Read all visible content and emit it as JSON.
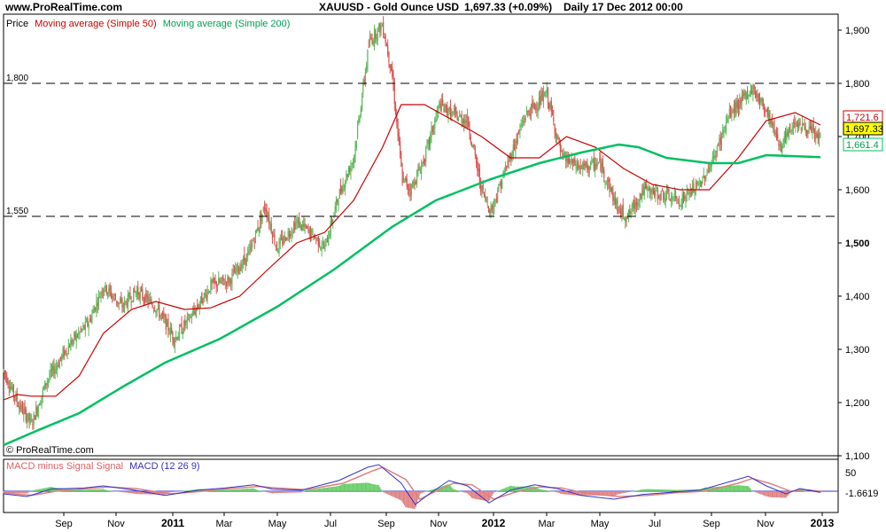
{
  "header": {
    "site": "www.ProRealTime.com",
    "instrument": "XAUUSD - Gold Ounce USD",
    "last_price": "1,697.33 (+0.09%)",
    "period": "Daily  17 Dec 2012 00:00"
  },
  "legend": {
    "price": "Price",
    "ma50": "Moving average (Simple 50)",
    "ma200": "Moving average (Simple 200)"
  },
  "watermark": "© ProRealTime.com",
  "macd_legend": {
    "hist": "MACD minus Signal Signal",
    "macd": "MACD (12 26 9)"
  },
  "colors": {
    "up": "#5cb85c",
    "down": "#d9534f",
    "ma50": "#cc0000",
    "ma200": "#00c060",
    "last_price_bg": "#ffff00",
    "macd_line": "#3333cc",
    "signal_line": "#e08080",
    "macd_hist": "#66cc66"
  },
  "chart_data": {
    "type": "line",
    "title": "XAUUSD - Gold Ounce USD",
    "ylim": [
      1100,
      1930
    ],
    "y_ticks": [
      {
        "value": 1100,
        "label": "1,100",
        "bold": false
      },
      {
        "value": 1200,
        "label": "1,200",
        "bold": false
      },
      {
        "value": 1300,
        "label": "1,300",
        "bold": false
      },
      {
        "value": 1400,
        "label": "1,400",
        "bold": false
      },
      {
        "value": 1500,
        "label": "1,500",
        "bold": true
      },
      {
        "value": 1600,
        "label": "1,600",
        "bold": false
      },
      {
        "value": 1700,
        "label": "1,700",
        "bold": false
      },
      {
        "value": 1800,
        "label": "1,800",
        "bold": false
      },
      {
        "value": 1900,
        "label": "1,900",
        "bold": false
      }
    ],
    "x_ticks": [
      "Sep",
      "Nov",
      "2011",
      "Mar",
      "May",
      "Jul",
      "Sep",
      "Nov",
      "2012",
      "Mar",
      "May",
      "Jul",
      "Sep",
      "Nov",
      "2013"
    ],
    "x_range": [
      "2010-07-26",
      "2013-01-05"
    ],
    "horizontal_lines": [
      {
        "value": 1800,
        "label": "1,800"
      },
      {
        "value": 1550,
        "label": "1,550"
      }
    ],
    "price_path": [
      [
        "2010-07-26",
        1260
      ],
      [
        "2010-08-10",
        1200
      ],
      [
        "2010-08-25",
        1160
      ],
      [
        "2010-09-10",
        1240
      ],
      [
        "2010-10-05",
        1310
      ],
      [
        "2010-10-25",
        1350
      ],
      [
        "2010-11-10",
        1420
      ],
      [
        "2010-11-30",
        1380
      ],
      [
        "2010-12-15",
        1410
      ],
      [
        "2011-01-05",
        1380
      ],
      [
        "2011-01-25",
        1320
      ],
      [
        "2011-02-15",
        1370
      ],
      [
        "2011-03-05",
        1420
      ],
      [
        "2011-03-25",
        1430
      ],
      [
        "2011-04-15",
        1480
      ],
      [
        "2011-05-02",
        1570
      ],
      [
        "2011-05-15",
        1490
      ],
      [
        "2011-06-05",
        1540
      ],
      [
        "2011-06-25",
        1510
      ],
      [
        "2011-07-05",
        1490
      ],
      [
        "2011-07-20",
        1590
      ],
      [
        "2011-08-05",
        1660
      ],
      [
        "2011-08-15",
        1790
      ],
      [
        "2011-08-22",
        1880
      ],
      [
        "2011-09-05",
        1910
      ],
      [
        "2011-09-15",
        1820
      ],
      [
        "2011-09-26",
        1620
      ],
      [
        "2011-10-05",
        1600
      ],
      [
        "2011-10-20",
        1660
      ],
      [
        "2011-11-05",
        1760
      ],
      [
        "2011-11-20",
        1740
      ],
      [
        "2011-12-05",
        1730
      ],
      [
        "2011-12-20",
        1600
      ],
      [
        "2011-12-30",
        1560
      ],
      [
        "2012-01-15",
        1640
      ],
      [
        "2012-02-05",
        1740
      ],
      [
        "2012-02-28",
        1780
      ],
      [
        "2012-03-15",
        1660
      ],
      [
        "2012-04-05",
        1640
      ],
      [
        "2012-04-25",
        1650
      ],
      [
        "2012-05-15",
        1560
      ],
      [
        "2012-05-25",
        1550
      ],
      [
        "2012-06-10",
        1600
      ],
      [
        "2012-06-30",
        1590
      ],
      [
        "2012-07-20",
        1580
      ],
      [
        "2012-08-10",
        1610
      ],
      [
        "2012-08-25",
        1660
      ],
      [
        "2012-09-10",
        1740
      ],
      [
        "2012-10-05",
        1790
      ],
      [
        "2012-10-20",
        1750
      ],
      [
        "2012-11-05",
        1680
      ],
      [
        "2012-11-20",
        1730
      ],
      [
        "2012-12-05",
        1710
      ],
      [
        "2012-12-17",
        1697
      ]
    ],
    "series": [
      {
        "name": "Moving average (Simple 50)",
        "last_label": "1,721.6",
        "points": [
          [
            "2010-07-26",
            1205
          ],
          [
            "2010-08-10",
            1215
          ],
          [
            "2010-08-25",
            1212
          ],
          [
            "2010-09-20",
            1212
          ],
          [
            "2010-10-15",
            1250
          ],
          [
            "2010-11-10",
            1330
          ],
          [
            "2010-12-10",
            1375
          ],
          [
            "2011-01-05",
            1390
          ],
          [
            "2011-02-05",
            1375
          ],
          [
            "2011-03-05",
            1378
          ],
          [
            "2011-04-05",
            1400
          ],
          [
            "2011-05-05",
            1450
          ],
          [
            "2011-06-05",
            1500
          ],
          [
            "2011-07-05",
            1520
          ],
          [
            "2011-08-05",
            1580
          ],
          [
            "2011-09-05",
            1680
          ],
          [
            "2011-09-25",
            1760
          ],
          [
            "2011-10-20",
            1760
          ],
          [
            "2011-11-20",
            1730
          ],
          [
            "2011-12-20",
            1700
          ],
          [
            "2012-01-20",
            1660
          ],
          [
            "2012-02-20",
            1660
          ],
          [
            "2012-03-20",
            1700
          ],
          [
            "2012-04-20",
            1680
          ],
          [
            "2012-05-20",
            1640
          ],
          [
            "2012-06-20",
            1610
          ],
          [
            "2012-07-20",
            1600
          ],
          [
            "2012-08-20",
            1600
          ],
          [
            "2012-09-20",
            1660
          ],
          [
            "2012-10-20",
            1730
          ],
          [
            "2012-11-20",
            1745
          ],
          [
            "2012-12-17",
            1721.6
          ]
        ]
      },
      {
        "name": "Moving average (Simple 200)",
        "last_label": "1,661.4",
        "points": [
          [
            "2010-07-26",
            1120
          ],
          [
            "2010-09-01",
            1148
          ],
          [
            "2010-10-15",
            1180
          ],
          [
            "2010-12-01",
            1230
          ],
          [
            "2011-01-15",
            1275
          ],
          [
            "2011-03-15",
            1320
          ],
          [
            "2011-05-15",
            1380
          ],
          [
            "2011-07-15",
            1450
          ],
          [
            "2011-09-15",
            1530
          ],
          [
            "2011-11-01",
            1580
          ],
          [
            "2011-12-30",
            1620
          ],
          [
            "2012-02-20",
            1650
          ],
          [
            "2012-04-05",
            1670
          ],
          [
            "2012-05-15",
            1685
          ],
          [
            "2012-06-05",
            1680
          ],
          [
            "2012-07-05",
            1660
          ],
          [
            "2012-08-20",
            1650
          ],
          [
            "2012-09-20",
            1650
          ],
          [
            "2012-10-20",
            1665
          ],
          [
            "2012-12-17",
            1661.4
          ]
        ]
      }
    ],
    "last_price_label": "1,697.33",
    "macd": {
      "ylim": [
        -40,
        60
      ],
      "y_tick": {
        "value": 50,
        "label": "50"
      },
      "last_label": "-1.6619",
      "macd_path": [
        [
          "2010-07-26",
          -5
        ],
        [
          "2010-08-20",
          -10
        ],
        [
          "2010-09-15",
          4
        ],
        [
          "2010-10-20",
          6
        ],
        [
          "2010-11-10",
          10
        ],
        [
          "2010-12-10",
          3
        ],
        [
          "2011-01-15",
          -8
        ],
        [
          "2011-02-20",
          2
        ],
        [
          "2011-03-20",
          6
        ],
        [
          "2011-04-20",
          12
        ],
        [
          "2011-05-10",
          4
        ],
        [
          "2011-06-10",
          2
        ],
        [
          "2011-07-20",
          20
        ],
        [
          "2011-08-20",
          45
        ],
        [
          "2011-09-01",
          50
        ],
        [
          "2011-09-25",
          15
        ],
        [
          "2011-10-10",
          -25
        ],
        [
          "2011-10-25",
          -5
        ],
        [
          "2011-11-15",
          20
        ],
        [
          "2011-12-05",
          10
        ],
        [
          "2011-12-28",
          -22
        ],
        [
          "2012-01-20",
          2
        ],
        [
          "2012-02-15",
          12
        ],
        [
          "2012-03-10",
          5
        ],
        [
          "2012-04-05",
          -8
        ],
        [
          "2012-05-10",
          -15
        ],
        [
          "2012-06-10",
          -6
        ],
        [
          "2012-07-10",
          -2
        ],
        [
          "2012-08-10",
          2
        ],
        [
          "2012-09-15",
          20
        ],
        [
          "2012-10-01",
          28
        ],
        [
          "2012-10-20",
          10
        ],
        [
          "2012-11-10",
          -5
        ],
        [
          "2012-11-25",
          5
        ],
        [
          "2012-12-17",
          -2
        ]
      ],
      "signal_path": [
        [
          "2010-07-26",
          -3
        ],
        [
          "2010-08-25",
          -8
        ],
        [
          "2010-09-20",
          0
        ],
        [
          "2010-10-25",
          5
        ],
        [
          "2010-11-15",
          8
        ],
        [
          "2010-12-15",
          5
        ],
        [
          "2011-01-20",
          -5
        ],
        [
          "2011-02-25",
          0
        ],
        [
          "2011-03-25",
          5
        ],
        [
          "2011-04-25",
          9
        ],
        [
          "2011-05-15",
          6
        ],
        [
          "2011-06-15",
          3
        ],
        [
          "2011-07-25",
          15
        ],
        [
          "2011-08-25",
          38
        ],
        [
          "2011-09-05",
          45
        ],
        [
          "2011-09-30",
          22
        ],
        [
          "2011-10-15",
          -15
        ],
        [
          "2011-11-01",
          0
        ],
        [
          "2011-11-20",
          15
        ],
        [
          "2011-12-10",
          12
        ],
        [
          "2012-01-02",
          -15
        ],
        [
          "2012-01-25",
          -2
        ],
        [
          "2012-02-20",
          8
        ],
        [
          "2012-03-15",
          6
        ],
        [
          "2012-04-10",
          -4
        ],
        [
          "2012-05-15",
          -10
        ],
        [
          "2012-06-15",
          -8
        ],
        [
          "2012-07-15",
          -3
        ],
        [
          "2012-08-15",
          0
        ],
        [
          "2012-09-20",
          15
        ],
        [
          "2012-10-05",
          24
        ],
        [
          "2012-10-25",
          14
        ],
        [
          "2012-11-15",
          0
        ],
        [
          "2012-11-30",
          3
        ],
        [
          "2012-12-17",
          0
        ]
      ]
    }
  }
}
